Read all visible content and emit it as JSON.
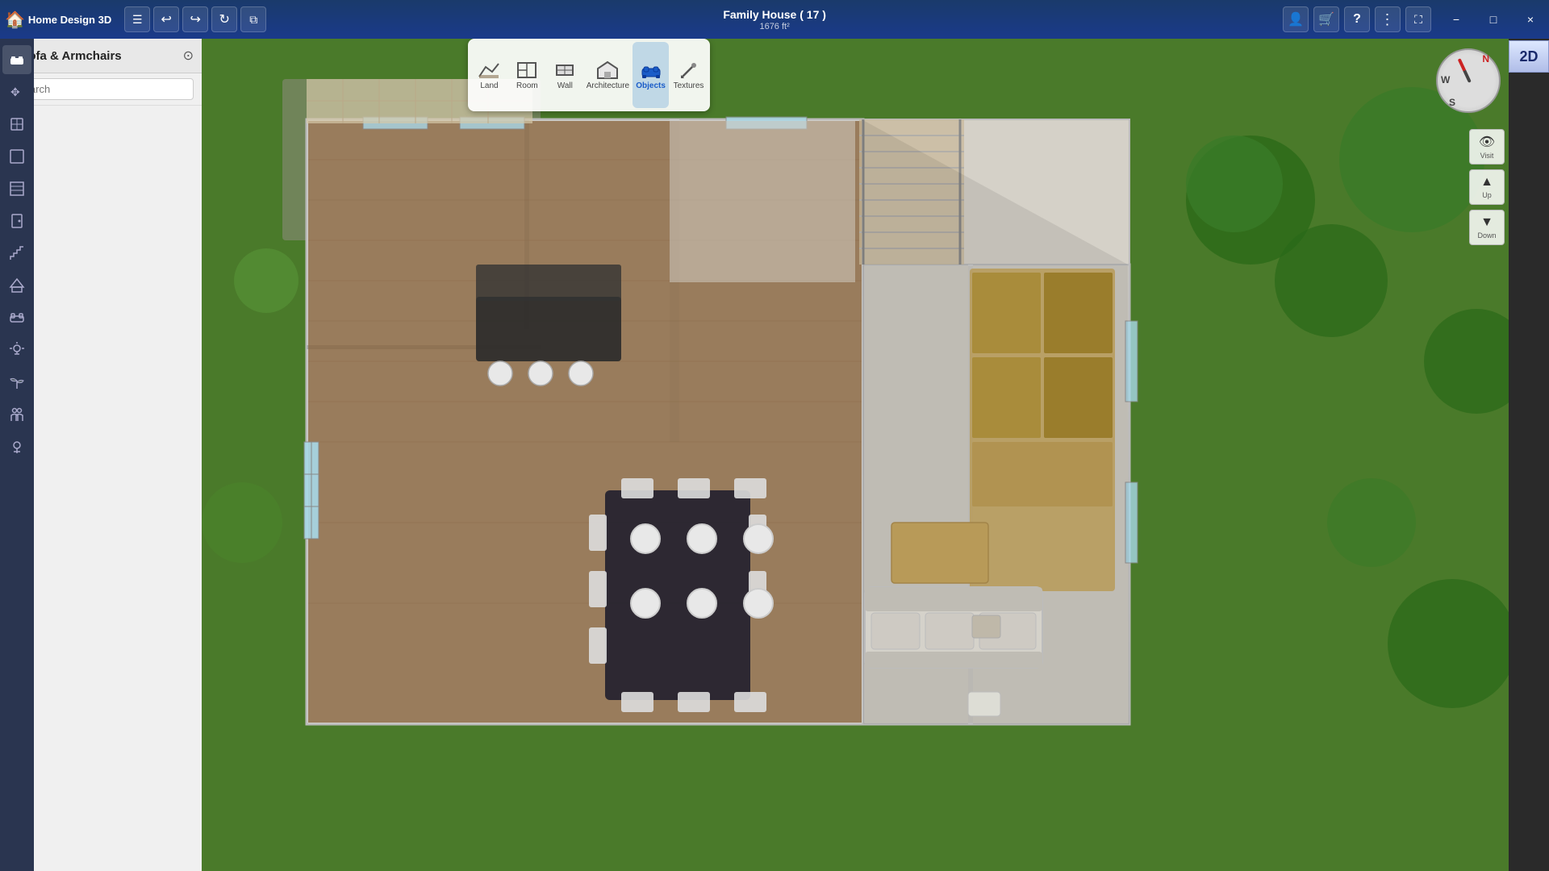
{
  "app": {
    "title": "Home Design 3D"
  },
  "titlebar": {
    "title": "Family House ( 17 )",
    "subtitle": "1676 ft²",
    "menu_icon": "☰",
    "undo_icon": "↩",
    "redo_icon": "↪",
    "refresh_icon": "↻",
    "copy_icon": "⧉",
    "user_icon": "👤",
    "cart_icon": "🛒",
    "help_icon": "?",
    "more_icon": "⋮",
    "expand_icon": "⛶",
    "minimize_label": "−",
    "maximize_label": "□",
    "close_label": "×"
  },
  "toolbar": {
    "tools": [
      {
        "id": "land",
        "label": "Land",
        "icon": "◱",
        "active": false
      },
      {
        "id": "room",
        "label": "Room",
        "icon": "⬜",
        "active": false
      },
      {
        "id": "wall",
        "label": "Wall",
        "icon": "▭",
        "active": false
      },
      {
        "id": "architecture",
        "label": "Architecture",
        "icon": "🏠",
        "active": false
      },
      {
        "id": "objects",
        "label": "Objects",
        "icon": "🛋",
        "active": true
      },
      {
        "id": "textures",
        "label": "Textures",
        "icon": "✏",
        "active": false
      }
    ]
  },
  "sidebar": {
    "category": "Sofa & Armchairs",
    "search_placeholder": "Search",
    "back_icon": "‹",
    "search_icon": "⊙"
  },
  "nav_icons": [
    {
      "id": "objects",
      "icon": "⬛",
      "active": true
    },
    {
      "id": "move",
      "icon": "✥"
    },
    {
      "id": "select",
      "icon": "⊞"
    },
    {
      "id": "rooms",
      "icon": "⬜"
    },
    {
      "id": "walls2",
      "icon": "▤"
    },
    {
      "id": "door",
      "icon": "🚪"
    },
    {
      "id": "stairs",
      "icon": "≡"
    },
    {
      "id": "roof",
      "icon": "△"
    },
    {
      "id": "furniture",
      "icon": "🪑"
    },
    {
      "id": "lighting",
      "icon": "✦"
    },
    {
      "id": "plants",
      "icon": "🌿"
    },
    {
      "id": "people",
      "icon": "👥"
    },
    {
      "id": "outdoor",
      "icon": "🌳"
    }
  ],
  "catalog": {
    "items": [
      {
        "id": 1,
        "color": "#8b1a1a",
        "is_new": true,
        "type": "sofa-3seat"
      },
      {
        "id": 2,
        "color": "#7a1515",
        "is_new": true,
        "type": "sofa-3seat"
      },
      {
        "id": 3,
        "color": "#8b2020",
        "is_new": true,
        "type": "sofa-curved"
      },
      {
        "id": 4,
        "color": "#c8a860",
        "is_new": false,
        "type": "sofa-3seat"
      },
      {
        "id": 5,
        "color": "#c8a860",
        "is_new": false,
        "type": "sofa-2seat"
      },
      {
        "id": 6,
        "color": "#1a6b7a",
        "is_new": true,
        "type": "sofa-corner"
      },
      {
        "id": 7,
        "color": "#9a9a9a",
        "is_new": true,
        "type": "sofa-3seat"
      },
      {
        "id": 8,
        "color": "#888",
        "is_new": true,
        "type": "sofa-2seat"
      },
      {
        "id": 9,
        "color": "#8b1a1a",
        "is_new": false,
        "type": "sofa-3seat"
      },
      {
        "id": 10,
        "color": "#2a2a4a",
        "is_new": false,
        "type": "sofa-2seat"
      },
      {
        "id": 11,
        "color": "#1a1a3a",
        "is_new": true,
        "type": "sofa-3seat"
      },
      {
        "id": 12,
        "color": "#8b2020",
        "is_new": true,
        "type": "sofa-corner"
      },
      {
        "id": 13,
        "color": "#1a1a1a",
        "is_new": false,
        "type": "sofa-3seat"
      },
      {
        "id": 14,
        "color": "#222",
        "is_new": false,
        "type": "sofa-3seat"
      },
      {
        "id": 15,
        "color": "#2a1a10",
        "is_new": false,
        "type": "sofa-3seat"
      },
      {
        "id": 16,
        "color": "#8b5a2a",
        "is_new": false,
        "type": "sofa-2seat"
      },
      {
        "id": 17,
        "color": "#d4c09a",
        "is_new": false,
        "type": "sofa-2seat"
      },
      {
        "id": 18,
        "color": "#e0d8c8",
        "is_new": false,
        "type": "sofa-3seat"
      },
      {
        "id": 19,
        "color": "#c8b890",
        "is_new": false,
        "type": "sofa-2seat"
      },
      {
        "id": 20,
        "color": "#c8c0a8",
        "is_new": false,
        "type": "sofa-3seat"
      },
      {
        "id": 21,
        "color": "#e8e0d0",
        "is_new": false,
        "type": "sofa-wide"
      },
      {
        "id": 22,
        "color": "#c8c0a8",
        "is_new": false,
        "type": "sofa-2seat"
      },
      {
        "id": 23,
        "color": "#d8d0b8",
        "is_new": false,
        "type": "sofa-3seat"
      },
      {
        "id": 24,
        "color": "#e0d8c8",
        "is_new": false,
        "type": "sofa-wide"
      },
      {
        "id": 25,
        "color": "#d8d0b8",
        "is_new": false,
        "type": "sofa-3seat"
      },
      {
        "id": 26,
        "color": "#1a1a1a",
        "is_new": false,
        "type": "sofa-2seat"
      },
      {
        "id": 27,
        "color": "#f0f0f0",
        "is_new": false,
        "type": "sofa-3seat"
      },
      {
        "id": 28,
        "color": "#bbb",
        "is_new": false,
        "type": "sofa-check"
      },
      {
        "id": 29,
        "color": "#d8e0c8",
        "is_new": false,
        "type": "sofa-2seat"
      },
      {
        "id": 30,
        "color": "#f0f0ee",
        "is_new": false,
        "type": "sofa-3seat"
      },
      {
        "id": 31,
        "color": "#888880",
        "is_new": false,
        "type": "sofa-3seat"
      },
      {
        "id": 32,
        "color": "#e8e0d0",
        "is_new": false,
        "type": "sofa-wide"
      },
      {
        "id": 33,
        "color": "#6b4a2a",
        "is_new": false,
        "type": "sofa-2seat"
      },
      {
        "id": 34,
        "color": "#1a1010",
        "is_new": false,
        "type": "sofa-3seat"
      },
      {
        "id": 35,
        "color": "#6b1a1a",
        "is_new": false,
        "type": "sofa-3seat"
      },
      {
        "id": 36,
        "color": "#8b1a1a",
        "is_new": false,
        "type": "sofa-2seat"
      }
    ]
  },
  "view": {
    "mode": "2D",
    "compass": {
      "north": "N",
      "south": "S",
      "west": "W"
    },
    "up_label": "Up",
    "down_label": "Down",
    "visit_label": "Visit"
  }
}
